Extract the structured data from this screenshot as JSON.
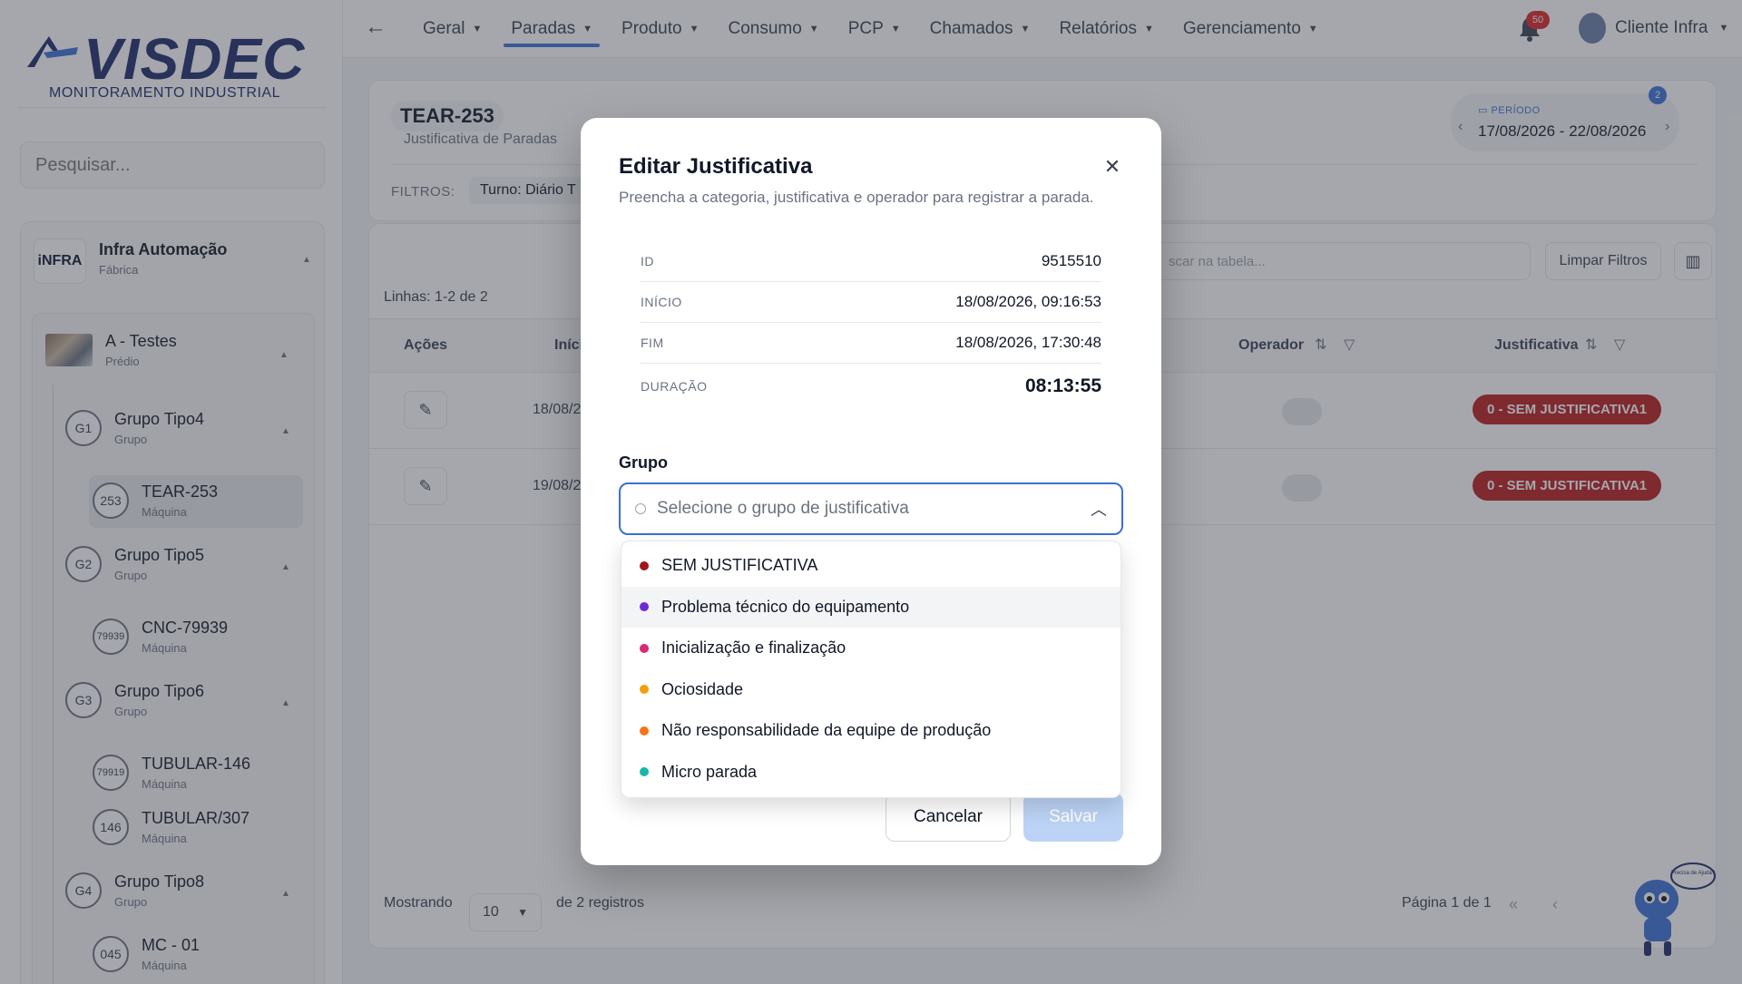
{
  "brand": {
    "name": "VISDEC",
    "subtitle": "MONITORAMENTO INDUSTRIAL"
  },
  "sidebar": {
    "search_placeholder": "Pesquisar...",
    "org": {
      "logo": "iNFRA",
      "title": "Infra Automação",
      "subtitle": "Fábrica"
    },
    "site": {
      "title": "A - Testes",
      "subtitle": "Prédio"
    },
    "groups": [
      {
        "badge": "G1",
        "title": "Grupo Tipo4",
        "subtitle": "Grupo",
        "machines": [
          {
            "badge": "253",
            "title": "TEAR-253",
            "subtitle": "Máquina"
          }
        ]
      },
      {
        "badge": "G2",
        "title": "Grupo Tipo5",
        "subtitle": "Grupo",
        "machines": [
          {
            "badge": "79939",
            "title": "CNC-79939",
            "subtitle": "Máquina"
          }
        ]
      },
      {
        "badge": "G3",
        "title": "Grupo Tipo6",
        "subtitle": "Grupo",
        "machines": [
          {
            "badge": "79919",
            "title": "TUBULAR-146",
            "subtitle": "Máquina"
          },
          {
            "badge": "146",
            "title": "TUBULAR/307",
            "subtitle": "Máquina"
          }
        ]
      },
      {
        "badge": "G4",
        "title": "Grupo Tipo8",
        "subtitle": "Grupo",
        "machines": [
          {
            "badge": "045",
            "title": "MC - 01",
            "subtitle": "Máquina"
          }
        ]
      }
    ]
  },
  "nav": {
    "items": [
      "Geral",
      "Paradas",
      "Produto",
      "Consumo",
      "PCP",
      "Chamados",
      "Relatórios",
      "Gerenciamento"
    ],
    "active": "Paradas",
    "notifications": "50",
    "user": "Cliente Infra"
  },
  "header": {
    "machine": "TEAR-253",
    "subtitle": "Justificativa de Paradas",
    "filters_label": "FILTROS:",
    "filter_chip": "Turno: Diário T",
    "period_label": "PERÍODO",
    "period_value": "17/08/2026 - 22/08/2026",
    "period_badge": "2"
  },
  "table": {
    "rows_count": "Linhas: 1-2 de 2",
    "search_placeholder": "scar na tabela...",
    "clear_filters": "Limpar Filtros",
    "columns": {
      "actions": "Ações",
      "start": "Iníci",
      "operator": "Operador",
      "justification": "Justificativa"
    },
    "rows": [
      {
        "start": "18/08/2",
        "justification": "0 - SEM JUSTIFICATIVA1"
      },
      {
        "start": "19/08/2",
        "justification": "0 - SEM JUSTIFICATIVA1"
      }
    ],
    "showing": "Mostrando",
    "page_size": "10",
    "records": "de 2 registros",
    "page_info": "Página 1 de 1"
  },
  "mascot": {
    "bubble": "Precisa de Ajuda?"
  },
  "modal": {
    "title": "Editar Justificativa",
    "description": "Preencha a categoria, justificativa e operador para registrar a parada.",
    "info": [
      {
        "label": "ID",
        "value": "9515510"
      },
      {
        "label": "INÍCIO",
        "value": "18/08/2026, 09:16:53"
      },
      {
        "label": "FIM",
        "value": "18/08/2026, 17:30:48"
      },
      {
        "label": "DURAÇÃO",
        "value": "08:13:55"
      }
    ],
    "group_label": "Grupo",
    "group_placeholder": "Selecione o grupo de justificativa",
    "options": [
      {
        "label": "SEM JUSTIFICATIVA",
        "color": "#a3141c"
      },
      {
        "label": "Problema técnico do equipamento",
        "color": "#6d28d9"
      },
      {
        "label": "Inicialização e finalização",
        "color": "#db2777"
      },
      {
        "label": "Ociosidade",
        "color": "#f59e0b"
      },
      {
        "label": "Não responsabilidade da equipe de produção",
        "color": "#f97316"
      },
      {
        "label": "Micro parada",
        "color": "#14b8a6"
      }
    ],
    "cancel": "Cancelar",
    "save": "Salvar"
  },
  "colors": {
    "accent": "#3b6fd8",
    "danger": "#b91c1c",
    "brand": "#1c2a6b"
  },
  "icons": [
    "back-arrow-icon",
    "bell-icon",
    "close-icon",
    "chevron-up-icon",
    "edit-pencil-icon",
    "filter-icon",
    "sort-icon",
    "columns-icon",
    "calendar-icon"
  ]
}
